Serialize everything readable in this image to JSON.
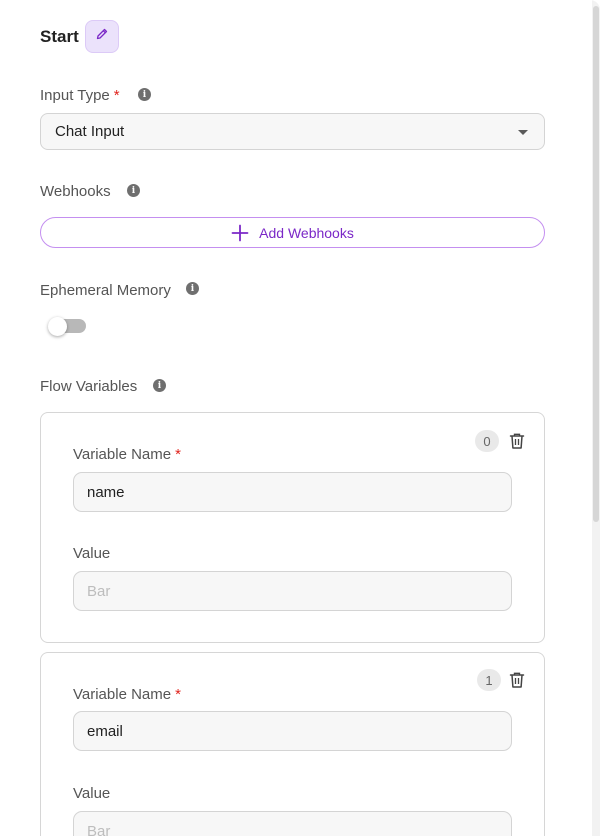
{
  "header": {
    "title": "Start"
  },
  "input_type": {
    "label": "Input Type",
    "required": "*",
    "value": "Chat Input"
  },
  "webhooks": {
    "label": "Webhooks",
    "add_label": "Add Webhooks"
  },
  "ephemeral": {
    "label": "Ephemeral Memory",
    "enabled": false
  },
  "flow_variables": {
    "label": "Flow Variables",
    "items": [
      {
        "index": "0",
        "name_label": "Variable Name",
        "required": "*",
        "name_value": "name",
        "value_label": "Value",
        "value_placeholder": "Bar"
      },
      {
        "index": "1",
        "name_label": "Variable Name",
        "required": "*",
        "name_value": "email",
        "value_label": "Value",
        "value_placeholder": "Bar"
      }
    ]
  },
  "colors": {
    "accent": "#7b28c7",
    "required": "#e0231c",
    "edit_bg": "#ebe2fb"
  },
  "icons": {
    "edit": "pencil-icon",
    "info": "info-icon",
    "add": "plus-icon",
    "delete": "trash-icon",
    "caret": "chevron-down-icon"
  }
}
